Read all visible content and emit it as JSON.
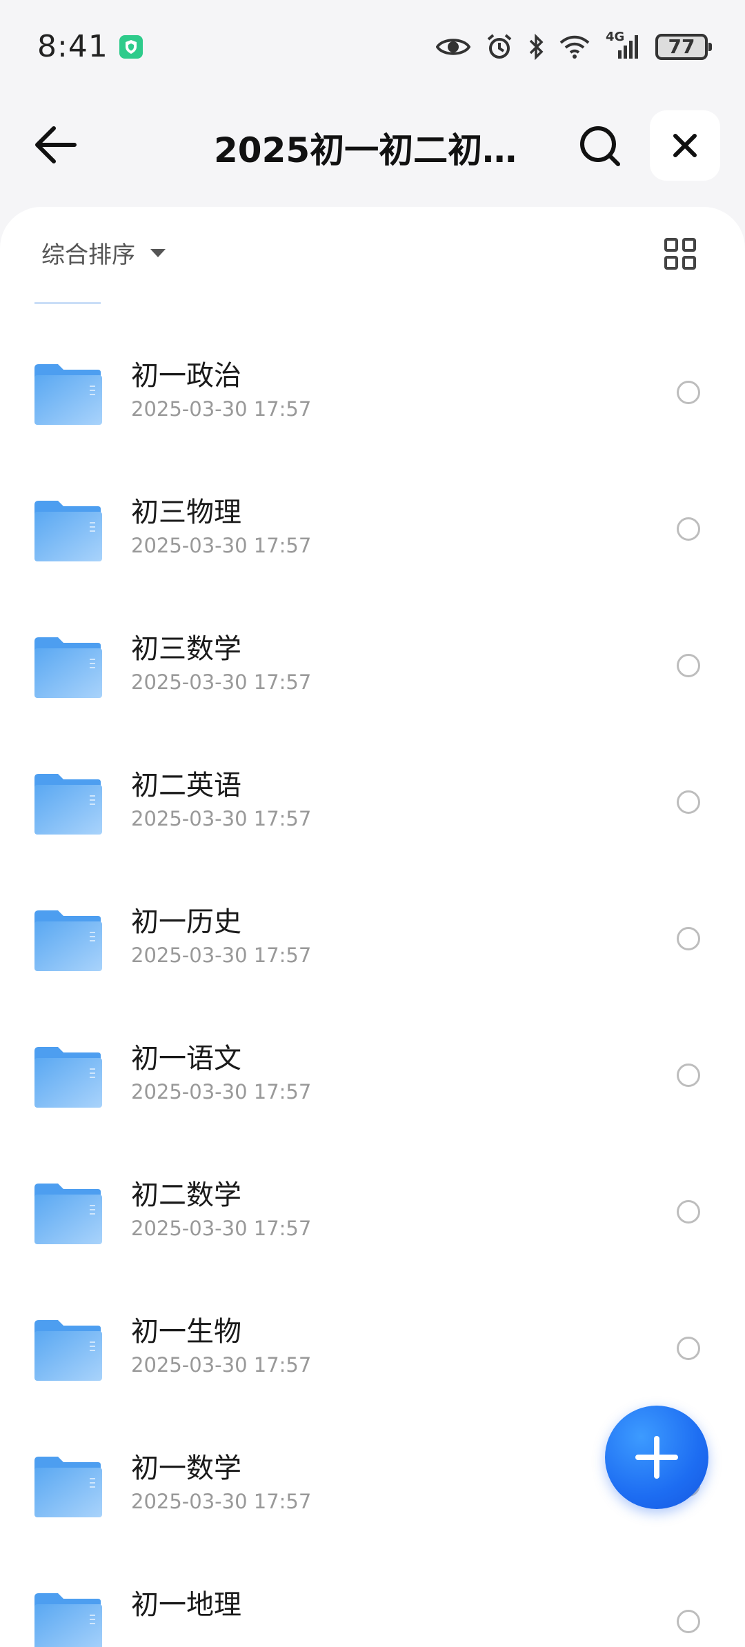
{
  "status_bar": {
    "time": "8:41",
    "network": "4G",
    "battery": "77",
    "icons": [
      "shield-icon",
      "eye-icon",
      "alarm-icon",
      "bluetooth-icon",
      "wifi-icon",
      "signal-icon",
      "battery-icon"
    ],
    "shield_color": "#2ecb8b"
  },
  "header": {
    "title": "2025初一初二初三...",
    "icons": [
      "back-arrow-icon",
      "search-icon",
      "close-icon"
    ]
  },
  "toolbar": {
    "sort_label": "综合排序",
    "icons": [
      "caret-down-icon",
      "grid-view-icon"
    ]
  },
  "folders": [
    {
      "name": "初一政治",
      "date": "2025-03-30 17:57"
    },
    {
      "name": "初三物理",
      "date": "2025-03-30 17:57"
    },
    {
      "name": "初三数学",
      "date": "2025-03-30 17:57"
    },
    {
      "name": "初二英语",
      "date": "2025-03-30 17:57"
    },
    {
      "name": "初一历史",
      "date": "2025-03-30 17:57"
    },
    {
      "name": "初一语文",
      "date": "2025-03-30 17:57"
    },
    {
      "name": "初二数学",
      "date": "2025-03-30 17:57"
    },
    {
      "name": "初一生物",
      "date": "2025-03-30 17:57"
    },
    {
      "name": "初一数学",
      "date": "2025-03-30 17:57"
    },
    {
      "name": "初一地理",
      "date": ""
    }
  ],
  "fab": {
    "icon": "plus-icon",
    "color": "#1d6df2"
  },
  "colors": {
    "folder": "#6cb4f5",
    "accent": "#1d6df2",
    "background": "#f5f5f7"
  }
}
